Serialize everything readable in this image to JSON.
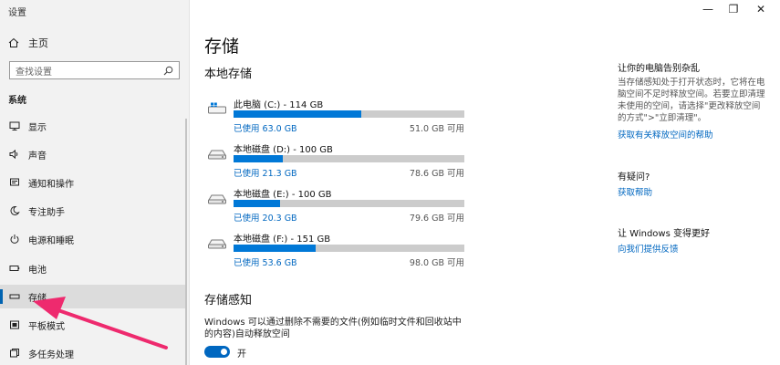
{
  "window": {
    "title": "设置",
    "minimize": "—",
    "maximize": "❐",
    "close": "✕"
  },
  "sidebar": {
    "home_label": "主页",
    "search_placeholder": "查找设置",
    "section_label": "系统",
    "items": [
      {
        "label": "显示",
        "icon": "monitor-icon"
      },
      {
        "label": "声音",
        "icon": "speaker-icon"
      },
      {
        "label": "通知和操作",
        "icon": "notification-icon"
      },
      {
        "label": "专注助手",
        "icon": "moon-icon"
      },
      {
        "label": "电源和睡眠",
        "icon": "power-icon"
      },
      {
        "label": "电池",
        "icon": "battery-icon"
      },
      {
        "label": "存储",
        "icon": "storage-icon",
        "active": true
      },
      {
        "label": "平板模式",
        "icon": "tablet-icon"
      },
      {
        "label": "多任务处理",
        "icon": "multitask-icon"
      }
    ]
  },
  "main": {
    "title": "存储",
    "local_storage_heading": "本地存储",
    "drives": [
      {
        "name": "此电脑 (C:) - 114 GB",
        "used": "已使用 63.0 GB",
        "free": "51.0 GB 可用",
        "used_fraction": 0.553,
        "icon": "windows-drive-icon"
      },
      {
        "name": "本地磁盘 (D:) - 100 GB",
        "used": "已使用 21.3 GB",
        "free": "78.6 GB 可用",
        "used_fraction": 0.213,
        "icon": "drive-icon"
      },
      {
        "name": "本地磁盘 (E:) - 100 GB",
        "used": "已使用 20.3 GB",
        "free": "79.6 GB 可用",
        "used_fraction": 0.203,
        "icon": "drive-icon"
      },
      {
        "name": "本地磁盘 (F:) - 151 GB",
        "used": "已使用 53.6 GB",
        "free": "98.0 GB 可用",
        "used_fraction": 0.355,
        "icon": "drive-icon"
      }
    ],
    "storage_sense_heading": "存储感知",
    "storage_sense_desc": "Windows 可以通过删除不需要的文件(例如临时文件和回收站中的内容)自动释放空间",
    "toggle_label": "开",
    "toggle_on": true
  },
  "right": {
    "h1": "让你的电脑告别杂乱",
    "p1": "当存储感知处于打开状态时，它将在电脑空间不足时释放空间。若要立即清理未使用的空间，请选择\"更改释放空间的方式\">\"立即清理\"。",
    "link1": "获取有关释放空间的帮助",
    "h2": "有疑问?",
    "link2": "获取帮助",
    "h3": "让 Windows 变得更好",
    "link3": "向我们提供反馈"
  },
  "colors": {
    "accent": "#0078d7",
    "link": "#0067c0",
    "arrow": "#ee2a6e"
  }
}
